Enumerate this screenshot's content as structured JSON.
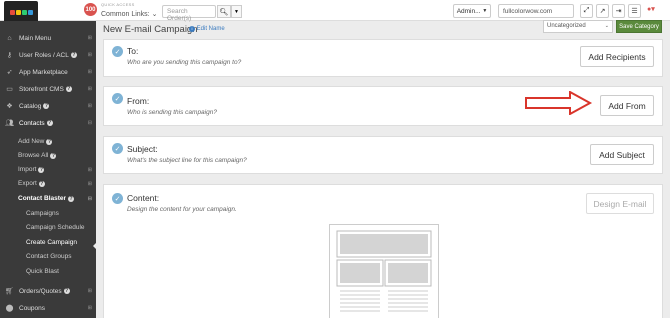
{
  "topbar": {
    "badge_count": "100",
    "quick_access": "QUICK ACCESS",
    "common_links": "Common Links:",
    "search_placeholder": "Search Order(s)",
    "admin_label": "Admin...",
    "domain": "fullcolorwow.com"
  },
  "sidebar": {
    "items": [
      {
        "label": "Main Menu"
      },
      {
        "label": "User Roles / ACL"
      },
      {
        "label": "App Marketplace"
      },
      {
        "label": "Storefront CMS"
      },
      {
        "label": "Catalog"
      },
      {
        "label": "Contacts"
      }
    ],
    "contacts_sub": [
      "Add New",
      "Browse All",
      "Import",
      "Export",
      "Contact Blaster"
    ],
    "blaster_sub": [
      "Campaigns",
      "Campaign Schedule",
      "Create Campaign",
      "Contact Groups",
      "Quick Blast"
    ],
    "bottom_items": [
      {
        "label": "Orders/Quotes"
      },
      {
        "label": "Coupons"
      }
    ]
  },
  "header": {
    "title": "New E-mail Campaign",
    "edit_name": "Edit Name",
    "category": "Uncategorized",
    "save_category": "Save Category"
  },
  "sections": {
    "to": {
      "title": "To:",
      "subtitle": "Who are you sending this campaign to?",
      "button": "Add Recipients"
    },
    "from": {
      "title": "From:",
      "subtitle": "Who is sending this campaign?",
      "button": "Add From"
    },
    "subject": {
      "title": "Subject:",
      "subtitle": "What's the subject line for this campaign?",
      "button": "Add Subject"
    },
    "content": {
      "title": "Content:",
      "subtitle": "Design the content for your campaign.",
      "button": "Design E-mail"
    }
  },
  "colors": {
    "sidebar_bg": "#3a3a3a",
    "save_green": "#5a8a3c",
    "check_blue": "#7fb3d5",
    "arrow_red": "#d9352b"
  }
}
